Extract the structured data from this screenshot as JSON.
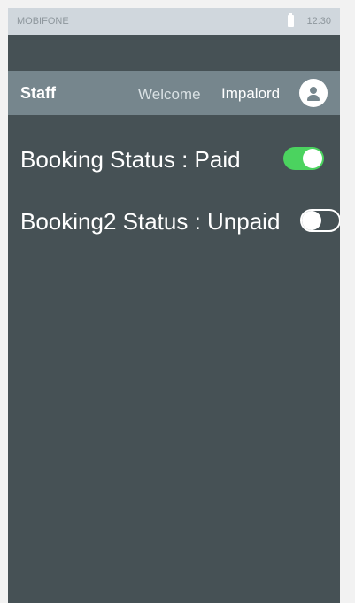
{
  "status_bar": {
    "carrier": "MOBIFONE",
    "time": "12:30",
    "battery_icon": "battery-icon"
  },
  "header": {
    "title": "Staff",
    "welcome": "Welcome",
    "username": "Impalord",
    "avatar_icon": "person-icon"
  },
  "bookings": [
    {
      "label": "Booking Status : Paid",
      "toggle_on": true
    },
    {
      "label": "Booking2 Status : Unpaid",
      "toggle_on": false
    }
  ],
  "colors": {
    "background": "#465155",
    "header_bg": "#76868d",
    "status_bar_bg": "#d0d7dd",
    "toggle_on": "#4bd35f",
    "text": "#ffffff"
  }
}
